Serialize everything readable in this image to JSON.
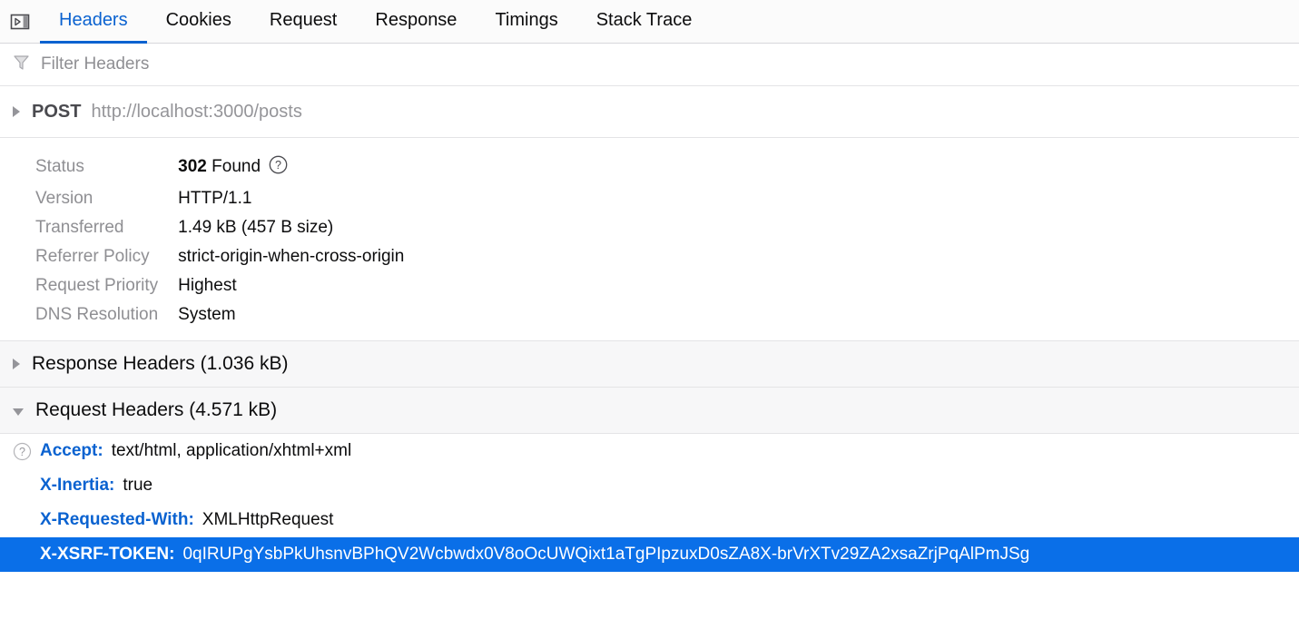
{
  "toolbar": {
    "panel_toggle_icon": "toggle-detail-panel-icon",
    "tabs": [
      {
        "label": "Headers",
        "active": true
      },
      {
        "label": "Cookies",
        "active": false
      },
      {
        "label": "Request",
        "active": false
      },
      {
        "label": "Response",
        "active": false
      },
      {
        "label": "Timings",
        "active": false
      },
      {
        "label": "Stack Trace",
        "active": false
      }
    ]
  },
  "filter": {
    "icon": "filter-funnel-icon",
    "value": "",
    "placeholder": "Filter Headers"
  },
  "request_summary": {
    "expanded": false,
    "method": "POST",
    "url": "http://localhost:3000/posts"
  },
  "details": [
    {
      "label": "Status",
      "value_bold": "302",
      "value": "Found",
      "help": true
    },
    {
      "label": "Version",
      "value_bold": "",
      "value": "HTTP/1.1",
      "help": false
    },
    {
      "label": "Transferred",
      "value_bold": "",
      "value": "1.49 kB (457 B size)",
      "help": false
    },
    {
      "label": "Referrer Policy",
      "value_bold": "",
      "value": "strict-origin-when-cross-origin",
      "help": false
    },
    {
      "label": "Request Priority",
      "value_bold": "",
      "value": "Highest",
      "help": false
    },
    {
      "label": "DNS Resolution",
      "value_bold": "",
      "value": "System",
      "help": false
    }
  ],
  "response_headers_section": {
    "label": "Response Headers (1.036 kB)",
    "expanded": false
  },
  "request_headers_section": {
    "label": "Request Headers (4.571 kB)",
    "expanded": true
  },
  "request_headers": [
    {
      "name": "Accept:",
      "value": "text/html, application/xhtml+xml",
      "help": true,
      "selected": false
    },
    {
      "name": "X-Inertia:",
      "value": "true",
      "help": false,
      "selected": false
    },
    {
      "name": "X-Requested-With:",
      "value": "XMLHttpRequest",
      "help": false,
      "selected": false
    },
    {
      "name": "X-XSRF-TOKEN:",
      "value": "0qIRUPgYsbPkUhsnvBPhQV2Wcbwdx0V8oOcUWQixt1aTgPIpzuxD0sZA8X-brVrXTv29ZA2xsaZrjPqAlPmJSg",
      "help": false,
      "selected": true
    }
  ],
  "colors": {
    "accent_blue": "#0a62d0",
    "selection_blue": "#0a6fe8",
    "label_gray": "#8f8f93",
    "section_bg": "#f7f7f8"
  }
}
